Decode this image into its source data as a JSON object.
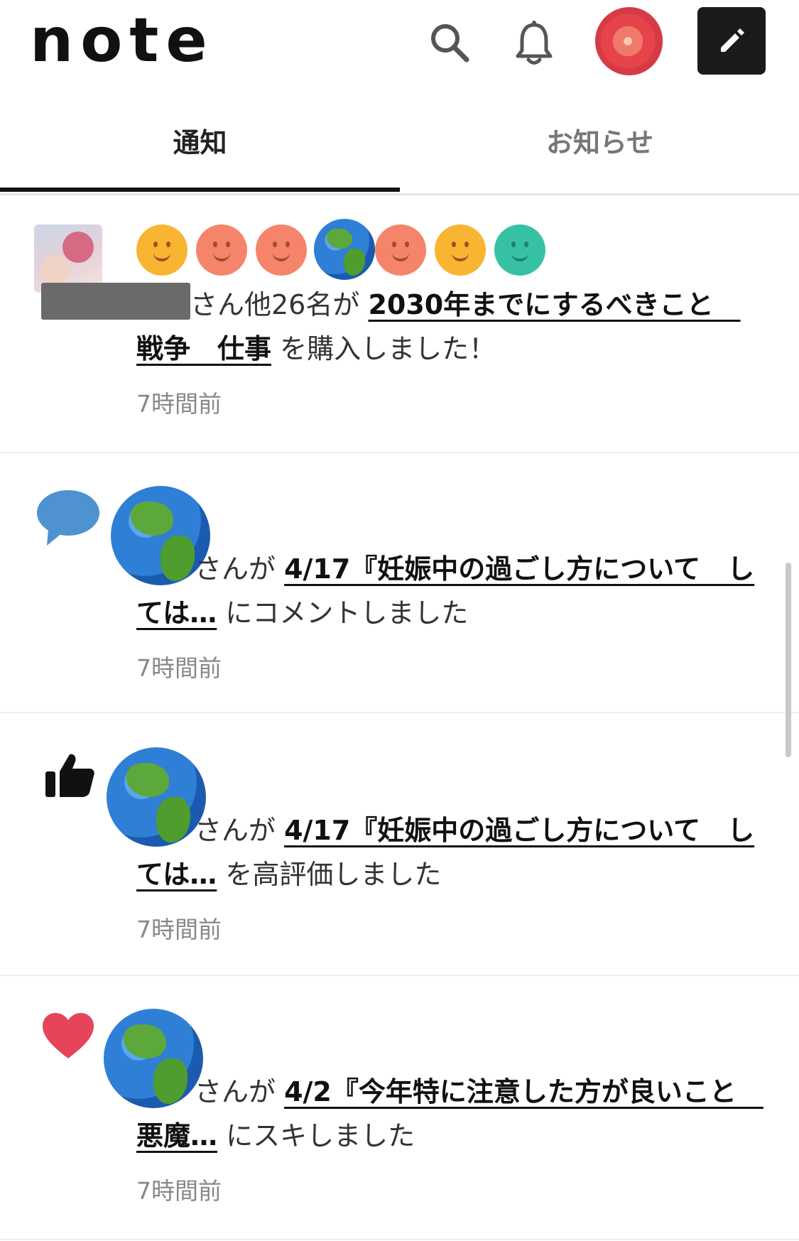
{
  "header": {
    "logo": "note",
    "icons": [
      "search-icon",
      "bell-icon",
      "avatar",
      "pencil-icon"
    ]
  },
  "tabs": [
    {
      "label": "通知",
      "active": true
    },
    {
      "label": "お知らせ",
      "active": false
    }
  ],
  "notifications": [
    {
      "text_before": "さん他26名が",
      "link": "2030年までにするべきこと　戦争　仕事",
      "text_after": "を購入しました！",
      "time": "7時間前",
      "icon": "flower-avatar"
    },
    {
      "text_before": "さんが",
      "link": "4/17『妊娠中の過ごし方について　しては…",
      "text_after": "にコメントしました",
      "time": "7時間前",
      "icon": "comment-icon"
    },
    {
      "text_before": "さんが",
      "link": "4/17『妊娠中の過ごし方について　しては…",
      "text_after": "を高評価しました",
      "time": "7時間前",
      "icon": "thumbs-up-icon"
    },
    {
      "text_before": "さんが",
      "link": "4/2『今年特に注意した方が良いこと　悪魔…",
      "text_after": "にスキしました",
      "time": "7時間前",
      "icon": "heart-icon"
    }
  ],
  "colors": {
    "heart": "#e5445b",
    "comment": "#4e93d0",
    "dark": "#111111"
  }
}
